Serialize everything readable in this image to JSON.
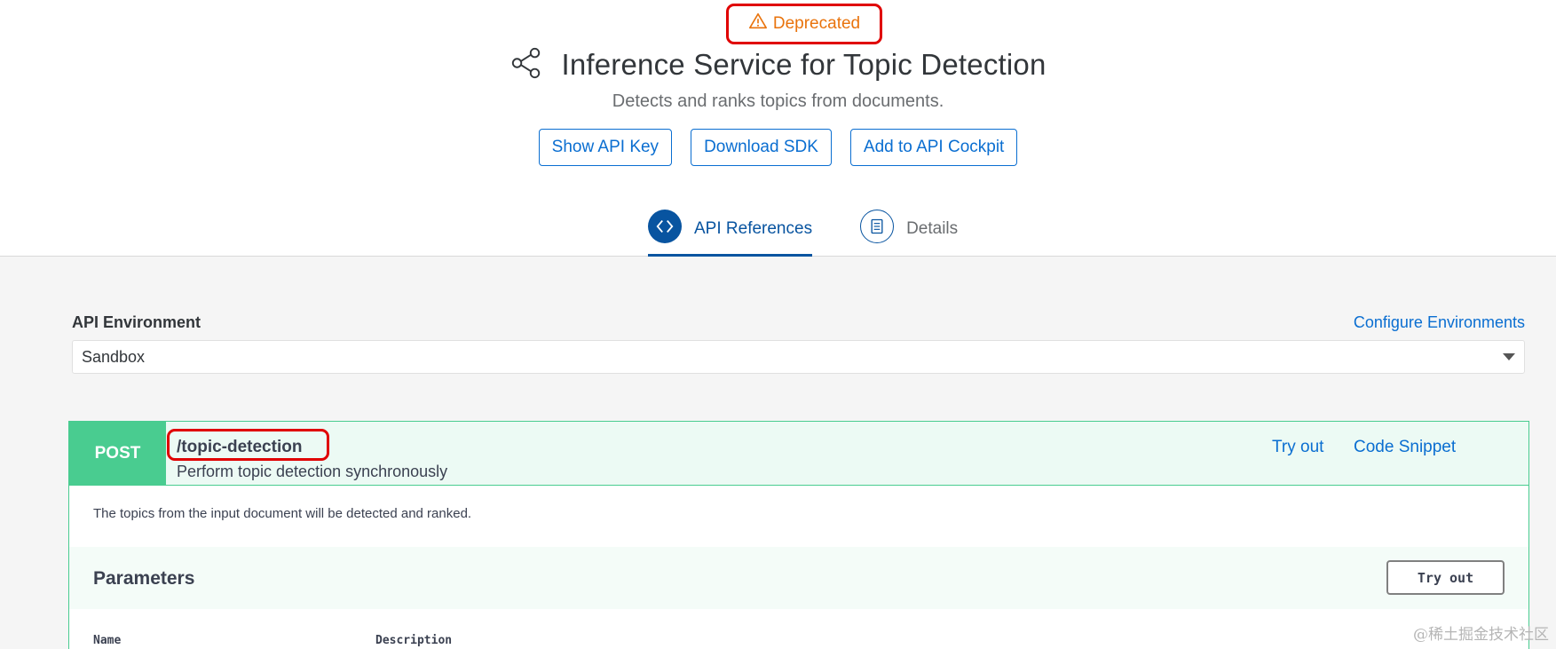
{
  "header": {
    "deprecated_label": "Deprecated",
    "title": "Inference Service for Topic Detection",
    "subtitle": "Detects and ranks topics from documents.",
    "buttons": {
      "show_api_key": "Show API Key",
      "download_sdk": "Download SDK",
      "add_to_cockpit": "Add to API Cockpit"
    },
    "tabs": [
      {
        "label": "API References",
        "icon": "code-icon",
        "active": true
      },
      {
        "label": "Details",
        "icon": "document-icon",
        "active": false
      }
    ]
  },
  "environment": {
    "label": "API Environment",
    "configure_link": "Configure Environments",
    "selected": "Sandbox"
  },
  "operation": {
    "method": "POST",
    "path": "/topic-detection",
    "summary": "Perform topic detection synchronously",
    "try_out_link": "Try out",
    "code_snippet_link": "Code Snippet",
    "description": "The topics from the input document will be detected and ranked.",
    "parameters_title": "Parameters",
    "try_out_button": "Try out",
    "columns": {
      "name": "Name",
      "description": "Description"
    }
  },
  "watermark": "@稀土掘金技术社区",
  "colors": {
    "accent": "#0a6ed1",
    "deprecated": "#e9730c",
    "post": "#49cc90",
    "highlight": "#e00000"
  }
}
